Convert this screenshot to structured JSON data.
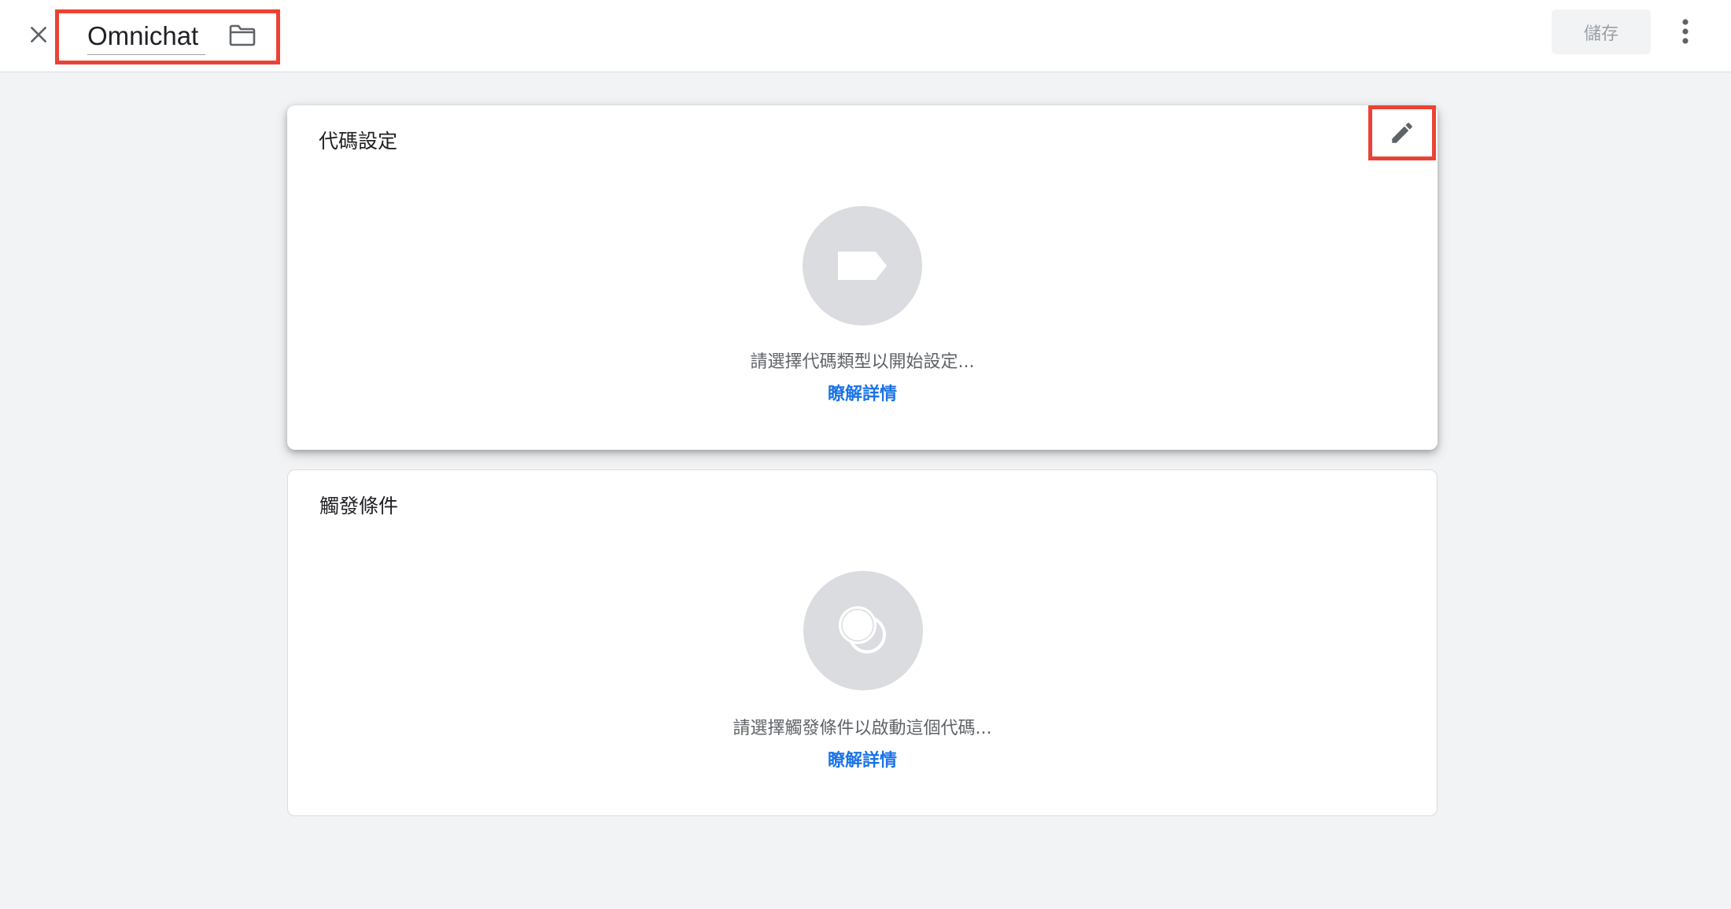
{
  "header": {
    "close_icon": "close-icon",
    "title_value": "Omnichat",
    "folder_icon": "folder-icon",
    "save_label": "儲存",
    "more_icon": "more-vert-icon"
  },
  "tag_config_card": {
    "title": "代碼設定",
    "edit_icon": "pencil-icon",
    "placeholder_icon": "tag-icon",
    "hint": "請選擇代碼類型以開始設定...",
    "learn_more": "瞭解詳情"
  },
  "trigger_card": {
    "title": "觸發條件",
    "placeholder_icon": "trigger-circles-icon",
    "hint": "請選擇觸發條件以啟動這個代碼...",
    "learn_more": "瞭解詳情"
  },
  "colors": {
    "accent_link": "#1a73e8",
    "highlight_box": "#ea4335",
    "background": "#f1f3f4"
  }
}
